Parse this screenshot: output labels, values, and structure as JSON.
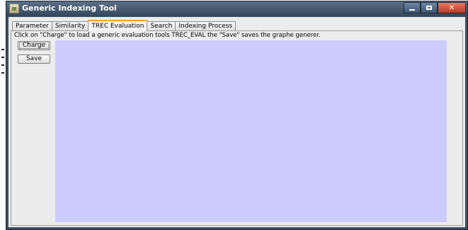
{
  "window": {
    "title": "Generic Indexing Tool",
    "title_bar_color": "#3d4f63",
    "close_color": "#c03a22"
  },
  "tabs": [
    {
      "label": "Parameter",
      "active": false
    },
    {
      "label": "Similarity",
      "active": false
    },
    {
      "label": "TREC Evaluation",
      "active": true
    },
    {
      "label": "Search",
      "active": false
    },
    {
      "label": "Indexing Process",
      "active": false
    }
  ],
  "trec_panel": {
    "hint": "Click on \"Charge\" to load a generic evaluation tools TREC_EVAL the \"Save\" saves the graphe generer.",
    "charge_label": "Charge",
    "save_label": "Save",
    "plot_background": "#ccccff"
  }
}
